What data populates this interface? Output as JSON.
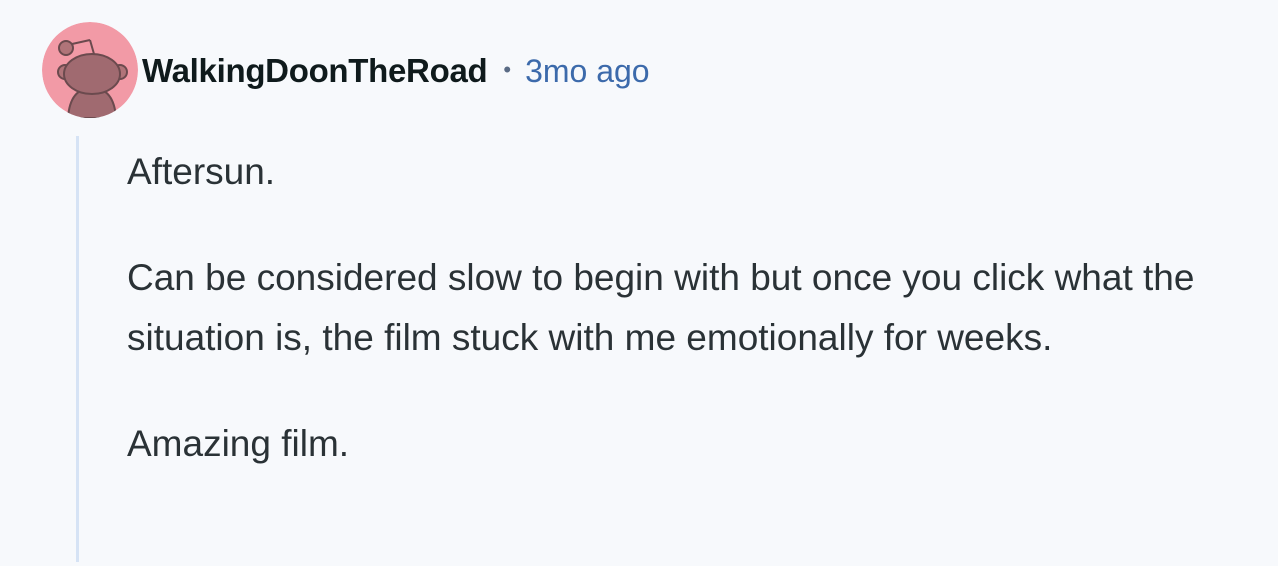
{
  "comment": {
    "author": "WalkingDoonTheRoad",
    "separator": "•",
    "timestamp": "3mo ago",
    "avatar_icon": "snoo-avatar-icon",
    "avatar_color": "#f29aa6",
    "paragraphs": [
      "Aftersun.",
      "Can be considered slow to begin with but once you click what the situation is, the film stuck with me emotionally for weeks.",
      "Amazing film."
    ]
  }
}
